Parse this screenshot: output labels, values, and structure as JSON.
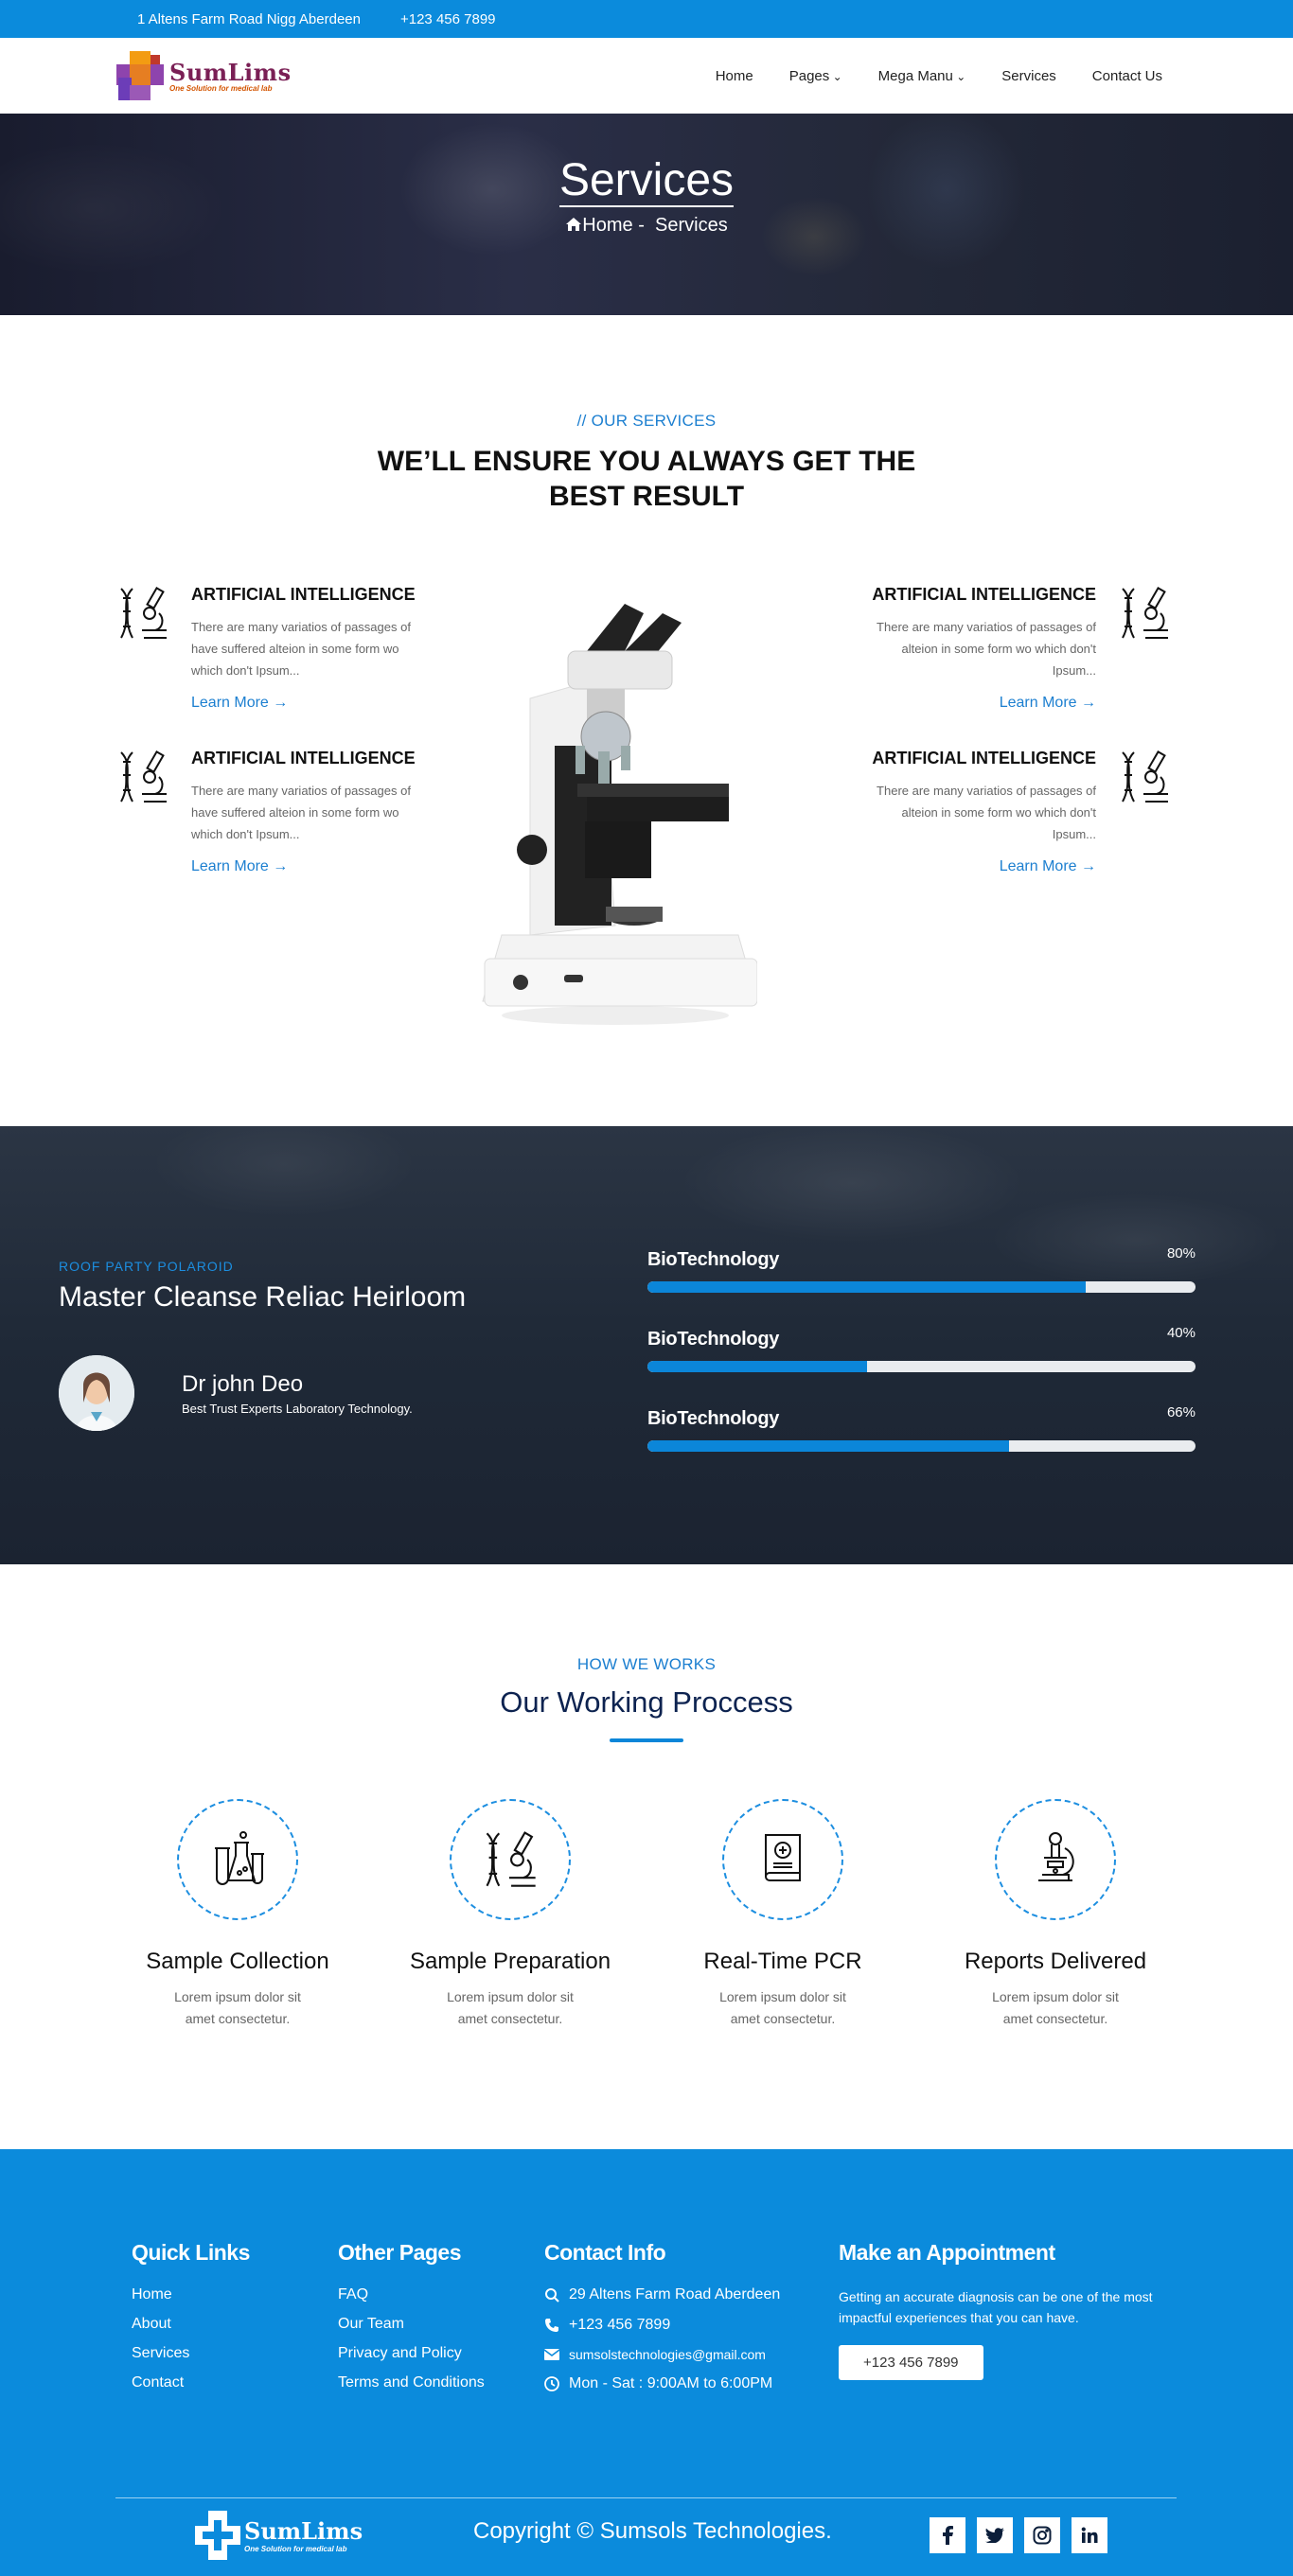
{
  "topbar": {
    "address": "1 Altens Farm Road Nigg Aberdeen",
    "phone": "+123 456 7899"
  },
  "brand": {
    "name": "SumLims",
    "tagline": "One Solution for medical lab"
  },
  "nav": {
    "items": [
      "Home",
      "Pages",
      "Mega Manu",
      "Services",
      "Contact Us"
    ]
  },
  "hero": {
    "title": "Services",
    "crumb_home": "Home",
    "crumb_sep": " - ",
    "crumb_current": "Services"
  },
  "services": {
    "eyebrow": "// OUR SERVICES",
    "title_line1": "WE’LL ENSURE YOU ALWAYS GET THE",
    "title_line2": "BEST RESULT",
    "items": [
      {
        "title": "ARTIFICIAL INTELLIGENCE",
        "text": "There are many variatios of passages of have suffered alteion in some form wo which don't Ipsum...",
        "link": "Learn More"
      },
      {
        "title": "ARTIFICIAL INTELLIGENCE",
        "text": "There are many variatios of passages of have suffered alteion in some form wo which don't Ipsum...",
        "link": "Learn More"
      },
      {
        "title": "ARTIFICIAL INTELLIGENCE",
        "text": "There are many variatios of passages of alteion in some form wo which don't Ipsum...",
        "link": "Learn More"
      },
      {
        "title": "ARTIFICIAL INTELLIGENCE",
        "text": "There are many variatios of passages of alteion in some form wo which don't Ipsum...",
        "link": "Learn More"
      }
    ],
    "icon": "dna-microscope-icon"
  },
  "skills": {
    "eyebrow": "ROOF PARTY POLAROID",
    "title": "Master Cleanse Reliac Heirloom",
    "doctor_name": "Dr john Deo",
    "doctor_sub": "Best Trust Experts Laboratory Technology.",
    "bars": [
      {
        "label": "BioTechnology",
        "value": 80,
        "text": "80%"
      },
      {
        "label": "BioTechnology",
        "value": 40,
        "text": "40%"
      },
      {
        "label": "BioTechnology",
        "value": 66,
        "text": "66%"
      }
    ]
  },
  "process": {
    "eyebrow": "HOW WE WORKS",
    "title": "Our Working Proccess",
    "steps": [
      {
        "title": "Sample Collection",
        "line1": "Lorem ipsum dolor sit",
        "line2": "amet consectetur.",
        "icon": "lab-flasks-icon"
      },
      {
        "title": "Sample Preparation",
        "line1": "Lorem ipsum dolor sit",
        "line2": "amet consectetur.",
        "icon": "dna-microscope-icon"
      },
      {
        "title": "Real-Time PCR",
        "line1": "Lorem ipsum dolor sit",
        "line2": "amet consectetur.",
        "icon": "medical-book-icon"
      },
      {
        "title": "Reports Delivered",
        "line1": "Lorem ipsum dolor sit",
        "line2": "amet consectetur.",
        "icon": "microscope-icon"
      }
    ]
  },
  "footer": {
    "quick_title": "Quick Links",
    "quick_links": [
      "Home",
      "About",
      "Services",
      "Contact"
    ],
    "other_title": "Other Pages",
    "other_links": [
      "FAQ",
      "Our Team",
      "Privacy and Policy",
      "Terms and Conditions"
    ],
    "contact_title": "Contact Info",
    "contact_address": "29 Altens Farm Road Aberdeen",
    "contact_phone": "+123 456 7899",
    "contact_email": "sumsolstechnologies@gmail.com",
    "contact_hours": "Mon - Sat : 9:00AM to 6:00PM",
    "appt_title": "Make an Appointment",
    "appt_text": "Getting an accurate diagnosis can be one of the most impactful experiences that you can have.",
    "appt_button": "+123 456 7899",
    "copyright": "Copyright © Sumsols Technologies.",
    "social": [
      "f",
      "t",
      "ig",
      "in"
    ]
  },
  "colors": {
    "primary": "#0b8bdc",
    "accent": "#1c7fd0",
    "dark": "#1f2937"
  }
}
